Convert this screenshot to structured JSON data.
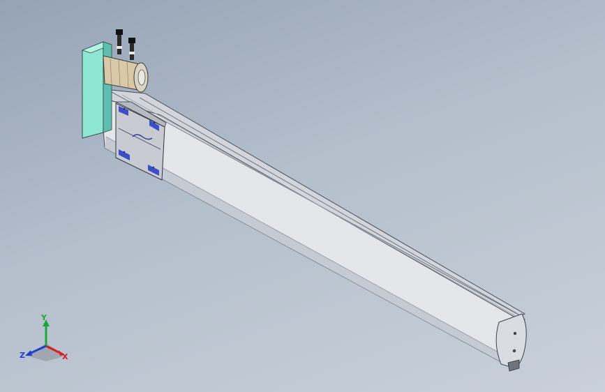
{
  "viewport": {
    "background_top": "#95a3b5",
    "background_bottom": "#c9d0d9"
  },
  "model": {
    "colors": {
      "rail_body": "#e6e8ec",
      "rail_shadow": "#b7bdc7",
      "rail_edge": "#4a4f58",
      "top_cover": "#d4d8de",
      "slot": "#8e949e",
      "carriage": "#c9ccd3",
      "carriage_accent": "#3d4fc4",
      "motor_mount": "#8ee6d3",
      "motor_mount_dark": "#5fbfae",
      "motor_body": "#d9c9a8",
      "motor_face": "#d8d4c8",
      "connector": "#2a2a2a"
    },
    "icons": [
      "connector-icon",
      "mount-bolt-icon"
    ]
  },
  "triad": {
    "x_label": "X",
    "y_label": "Y",
    "z_label": "Z",
    "x_color": "#d62020",
    "y_color": "#1aa83a",
    "z_color": "#2040d0"
  }
}
